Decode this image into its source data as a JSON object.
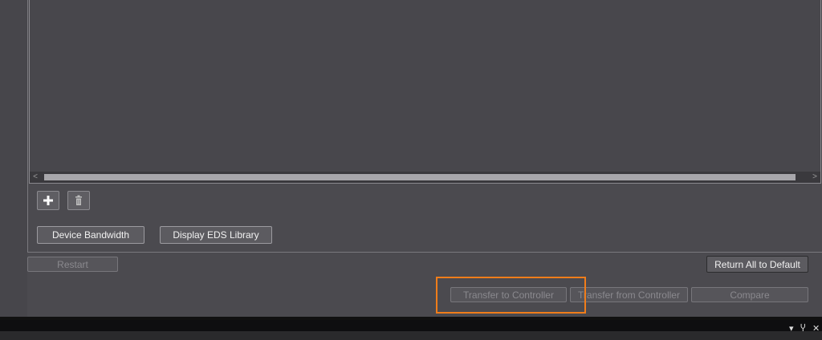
{
  "toolbar": {
    "add_icon": "plus-icon",
    "delete_icon": "trash-icon"
  },
  "buttons": {
    "device_bandwidth": "Device Bandwidth",
    "display_eds_library": "Display EDS Library",
    "restart": "Restart",
    "return_all_default": "Return All to Default",
    "transfer_to_controller": "Transfer to Controller",
    "transfer_from_controller": "Transfer from Controller",
    "compare": "Compare"
  },
  "scrollbar": {
    "left_arrow": "<",
    "right_arrow": ">"
  },
  "window_controls": {
    "dropdown": "▾",
    "pin": "Ⴤ",
    "close": "✕"
  },
  "colors": {
    "background": "#4b4a4f",
    "highlight": "#f07d1a"
  }
}
